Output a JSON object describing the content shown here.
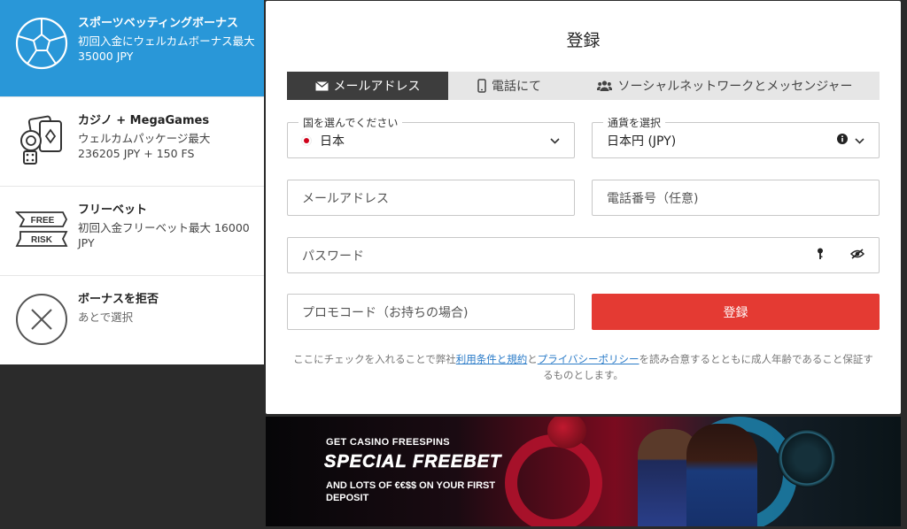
{
  "bonuses": [
    {
      "title": "スポーツベッティングボーナス",
      "desc": "初回入金にウェルカムボーナス最大35000 JPY",
      "icon": "soccer-ball-icon"
    },
    {
      "title": "カジノ + MegaGames",
      "desc": "ウェルカムパッケージ最大 236205 JPY + 150 FS",
      "icon": "casino-cards-chips-icon"
    },
    {
      "title": "フリーベット",
      "desc": "初回入金フリーベット最大 16000 JPY",
      "icon": "free-risk-icon"
    },
    {
      "title": "ボーナスを拒否",
      "desc": "あとで選択",
      "icon": "close-circle-icon"
    }
  ],
  "icon_text": {
    "free": "FREE",
    "risk": "RISK"
  },
  "form": {
    "title": "登録",
    "tabs": [
      {
        "label": "メールアドレス",
        "icon": "envelope-icon"
      },
      {
        "label": "電話にて",
        "icon": "phone-icon"
      },
      {
        "label": "ソーシャルネットワークとメッセンジャー",
        "icon": "users-icon"
      }
    ],
    "country": {
      "legend": "国を選んでください",
      "value": "日本"
    },
    "currency": {
      "legend": "通貨を選択",
      "value": "日本円 (JPY)"
    },
    "email_placeholder": "メールアドレス",
    "phone_placeholder": "電話番号（任意)",
    "password_placeholder": "パスワード",
    "promo_placeholder": "プロモコード（お持ちの場合)",
    "submit_label": "登録",
    "terms": {
      "pre": "ここにチェックを入れることで弊社",
      "link1": "利用条件と規約",
      "mid": "と",
      "link2": "プライバシーポリシー",
      "post": "を読み合意するとともに成人年齢であること保証するものとします。"
    }
  },
  "banner": {
    "line1": "GET CASINO FREESPINS",
    "line2": "SPECIAL FREEBET",
    "line3": "AND LOTS OF €€$$ ON YOUR FIRST DEPOSIT"
  },
  "colors": {
    "accent_blue": "#2997d8",
    "submit_red": "#e43a33",
    "tab_dark": "#3d3d3d"
  }
}
